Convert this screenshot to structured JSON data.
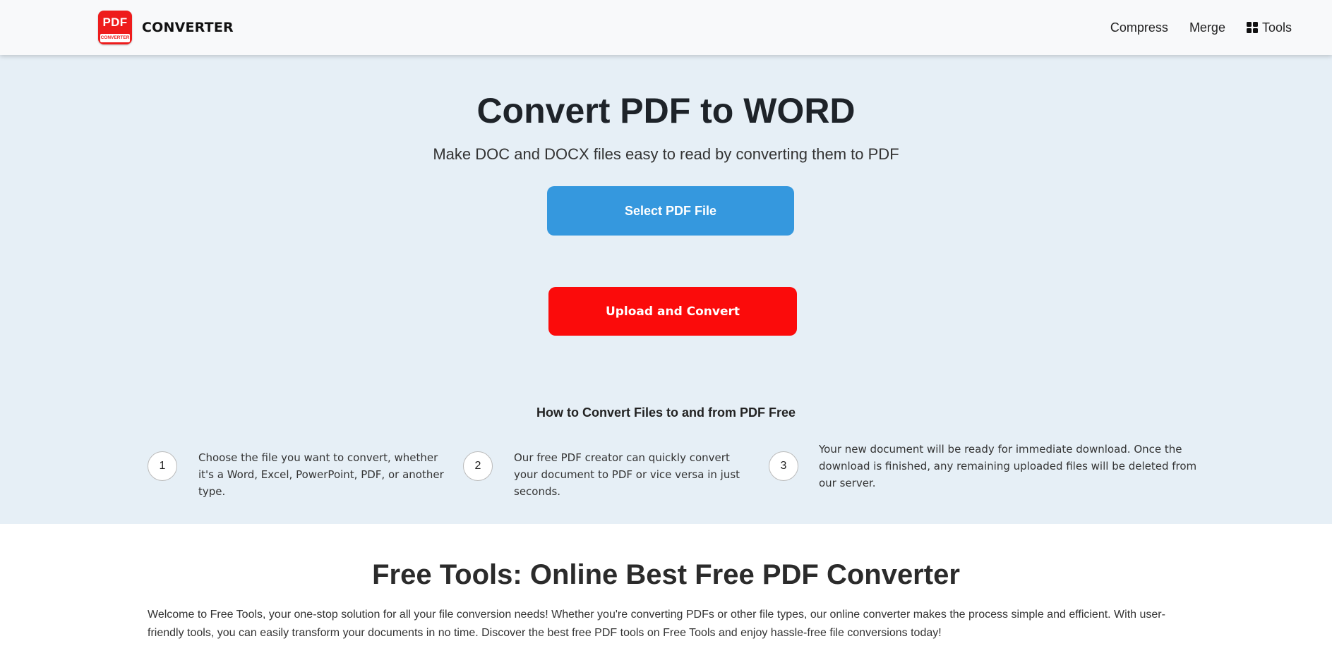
{
  "navbar": {
    "logo_text": "PDF",
    "logo_subtext": "CONVERTER",
    "brand_name": "CONVERTER",
    "links": [
      {
        "label": "Compress"
      },
      {
        "label": "Merge"
      },
      {
        "label": "Tools",
        "icon": "grid-icon"
      }
    ]
  },
  "hero": {
    "title": "Convert PDF to WORD",
    "subtitle": "Make DOC and DOCX files easy to read by converting them to PDF",
    "select_button": "Select PDF File",
    "upload_button": "Upload and Convert",
    "howto_title": "How to Convert Files to and from PDF Free",
    "steps": [
      {
        "number": "1",
        "text": "Choose the file you want to convert, whether it's a Word, Excel, PowerPoint, PDF, or another type."
      },
      {
        "number": "2",
        "text": "Our free PDF creator can quickly convert your document to PDF or vice versa in just seconds."
      },
      {
        "number": "3",
        "text": "Your new document will be ready for immediate download. Once the download is finished, any remaining uploaded files will be deleted from our server."
      }
    ]
  },
  "about": {
    "title": "Free Tools: Online Best Free PDF Converter",
    "paragraph": "Welcome to Free Tools, your one-stop solution for all your file conversion needs! Whether you're converting PDFs or other file types, our online converter makes the process simple and efficient. With user-friendly tools, you can easily transform your documents in no time. Discover the best free PDF tools on Free Tools and enjoy hassle-free file conversions today!"
  },
  "colors": {
    "hero_background": "#e6eff6",
    "select_button": "#3598de",
    "upload_button": "#fb0b0b",
    "logo": "#ee1c1c",
    "navbar_background": "#f8f9fa"
  }
}
